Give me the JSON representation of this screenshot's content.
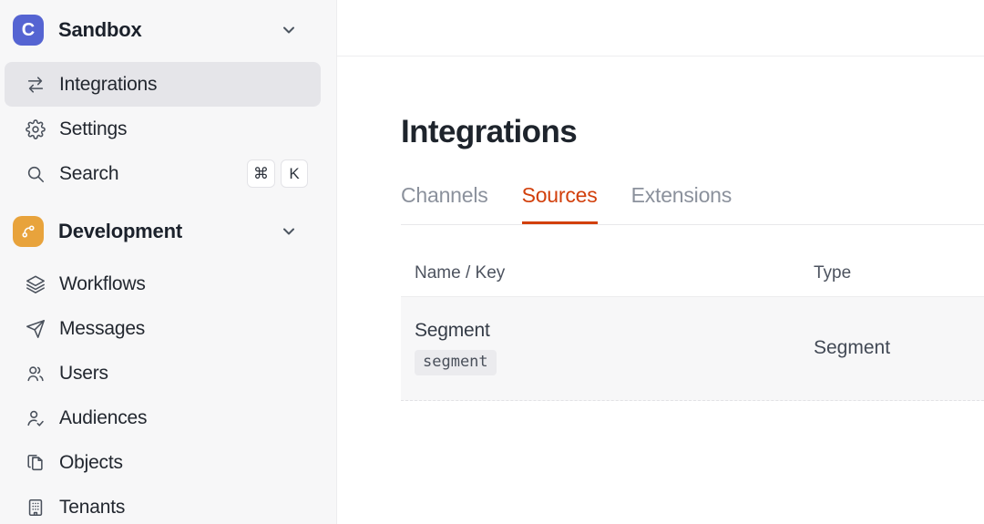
{
  "sidebar": {
    "workspace": {
      "logo_letter": "C",
      "name": "Sandbox"
    },
    "items": [
      {
        "label": "Integrations",
        "icon": "swap-arrows-icon",
        "active": true
      },
      {
        "label": "Settings",
        "icon": "gear-icon",
        "active": false
      },
      {
        "label": "Search",
        "icon": "search-icon",
        "active": false
      }
    ],
    "search_shortcut": [
      "⌘",
      "K"
    ],
    "section": {
      "name": "Development",
      "icon": "branch-icon"
    },
    "dev_items": [
      {
        "label": "Workflows",
        "icon": "layers-icon"
      },
      {
        "label": "Messages",
        "icon": "send-icon"
      },
      {
        "label": "Users",
        "icon": "users-icon"
      },
      {
        "label": "Audiences",
        "icon": "person-check-icon"
      },
      {
        "label": "Objects",
        "icon": "copy-icon"
      },
      {
        "label": "Tenants",
        "icon": "building-icon"
      }
    ]
  },
  "main": {
    "title": "Integrations",
    "tabs": [
      {
        "label": "Channels",
        "active": false
      },
      {
        "label": "Sources",
        "active": true
      },
      {
        "label": "Extensions",
        "active": false
      }
    ],
    "table": {
      "columns": [
        "Name / Key",
        "Type"
      ],
      "rows": [
        {
          "name": "Segment",
          "key": "segment",
          "type": "Segment"
        }
      ]
    }
  },
  "colors": {
    "accent_red": "#d2400c",
    "logo_indigo": "#5564d2",
    "dev_orange": "#e8a33c",
    "sidebar_bg": "#f7f7f8",
    "active_item_bg": "#e5e5e9",
    "row_bg": "#f7f7f8"
  }
}
